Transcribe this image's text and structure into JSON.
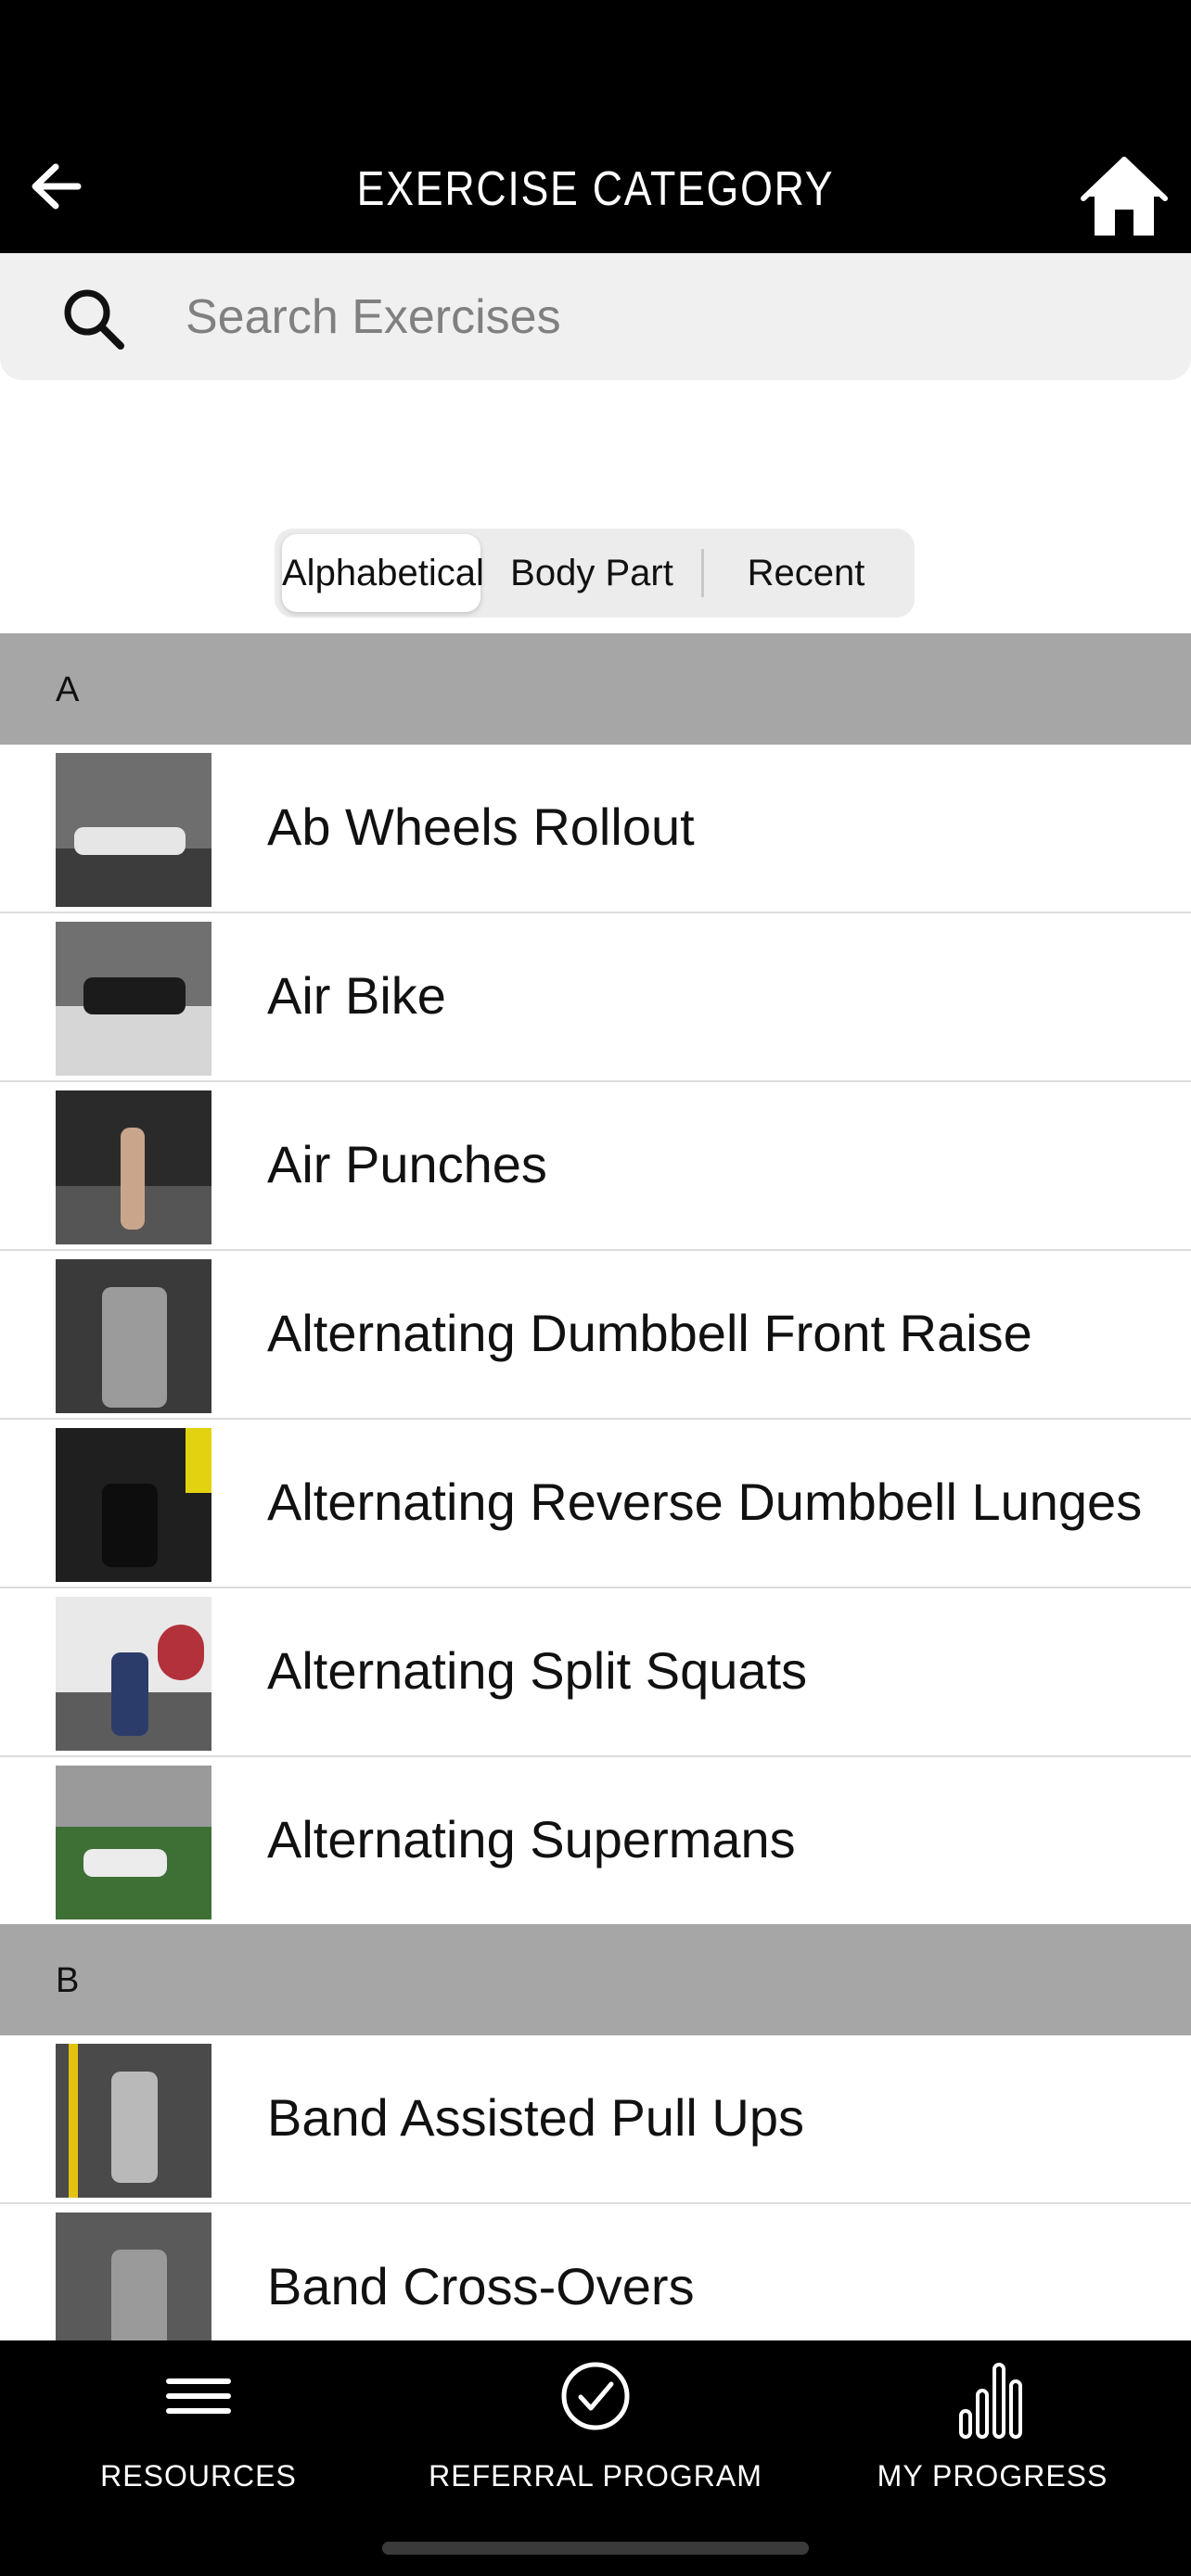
{
  "header": {
    "title": "EXERCISE CATEGORY",
    "back_icon": "back-arrow-icon",
    "home_icon": "home-icon"
  },
  "search": {
    "placeholder": "Search Exercises",
    "value": "",
    "icon": "search-icon"
  },
  "sort_tabs": [
    {
      "label": "Alphabetical",
      "selected": true
    },
    {
      "label": "Body Part",
      "selected": false
    },
    {
      "label": "Recent",
      "selected": false
    }
  ],
  "sections": [
    {
      "letter": "A",
      "items": [
        {
          "name": "Ab Wheels Rollout"
        },
        {
          "name": "Air Bike"
        },
        {
          "name": "Air Punches"
        },
        {
          "name": "Alternating Dumbbell Front Raise"
        },
        {
          "name": "Alternating Reverse Dumbbell Lunges"
        },
        {
          "name": "Alternating Split Squats"
        },
        {
          "name": "Alternating Supermans"
        }
      ]
    },
    {
      "letter": "B",
      "items": [
        {
          "name": "Band Assisted Pull Ups"
        },
        {
          "name": "Band Cross-Overs"
        }
      ]
    }
  ],
  "tabbar": [
    {
      "label": "RESOURCES",
      "icon": "menu-lines-icon"
    },
    {
      "label": "REFERRAL PROGRAM",
      "icon": "check-circle-icon"
    },
    {
      "label": "MY PROGRESS",
      "icon": "bar-chart-icon"
    }
  ],
  "colors": {
    "bar_bg": "#000000",
    "section_header_bg": "#a6a6a6",
    "search_bg": "#f0f0f1"
  }
}
